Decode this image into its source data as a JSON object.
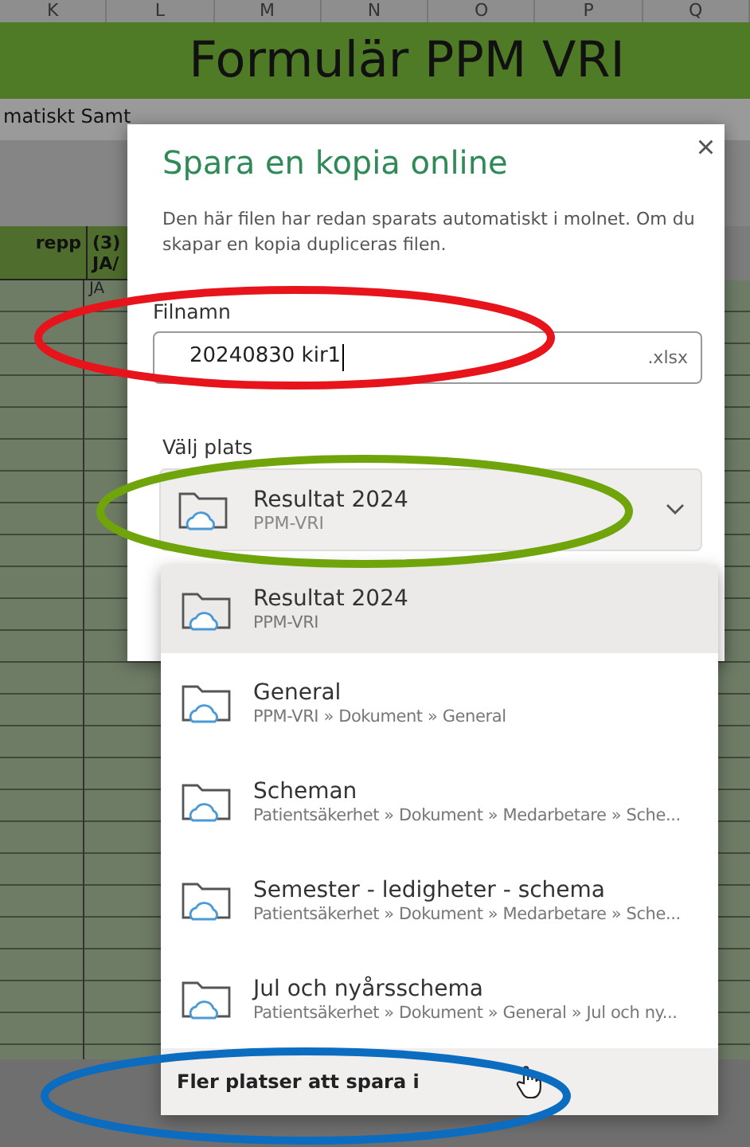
{
  "sheet": {
    "column_headers": [
      "K",
      "L",
      "M",
      "N",
      "O",
      "P",
      "Q"
    ],
    "title": "Formulär PPM VRI",
    "note": "matiskt Samt",
    "table_headers": [
      "repp",
      "(3)\nJA/"
    ],
    "cell": "JA"
  },
  "dialog": {
    "title": "Spara en kopia online",
    "close": "×",
    "description": "Den här filen har redan sparats automatiskt i molnet. Om du skapar en kopia dupliceras filen.",
    "filename_label": "Filnamn",
    "filename": {
      "value": "20240830 kir1",
      "suffix": ".xlsx"
    },
    "location_label": "Välj plats",
    "location": {
      "name": "Resultat 2024",
      "path": "PPM-VRI",
      "expanded": true
    }
  },
  "locations": [
    {
      "name": "Resultat 2024",
      "path": "PPM-VRI",
      "selected": true
    },
    {
      "name": "General",
      "path": "PPM-VRI » Dokument » General",
      "selected": false
    },
    {
      "name": "Scheman",
      "path": "Patientsäkerhet » Dokument » Medarbetare » Sche...",
      "selected": false
    },
    {
      "name": "Semester - ledigheter - schema",
      "path": "Patientsäkerhet » Dokument » Medarbetare » Sche...",
      "selected": false
    },
    {
      "name": "Jul och nyårsschema",
      "path": "Patientsäkerhet » Dokument » General » Jul och ny...",
      "selected": false
    }
  ],
  "more_locations": "Fler platser att spara i",
  "annotations": [
    {
      "color": "#e8141b"
    },
    {
      "color": "#6fa50a"
    },
    {
      "color": "#0b6cc0"
    }
  ]
}
